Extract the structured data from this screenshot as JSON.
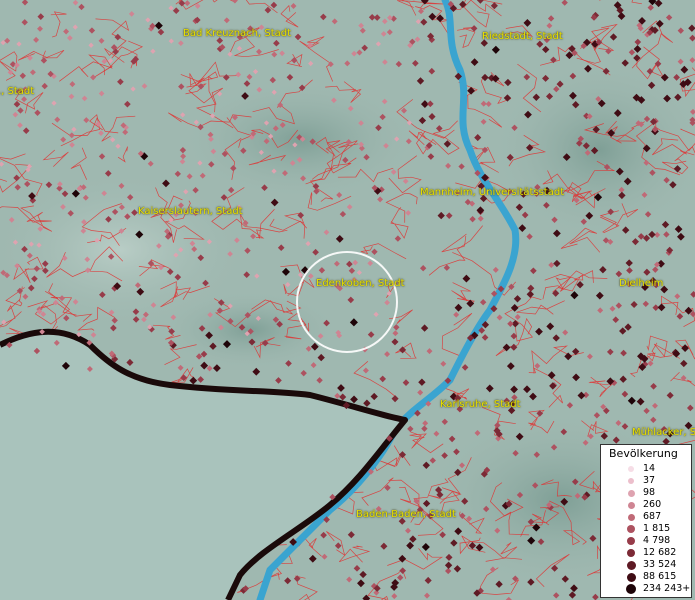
{
  "map": {
    "place_labels": [
      {
        "id": "bad-kreuznach",
        "text": "Bad Kreuznach, Stadt"
      },
      {
        "id": "riedstadt",
        "text": "Riedstadt, Stadt"
      },
      {
        "id": "left-cut",
        "text": "., Stadt"
      },
      {
        "id": "mannheim",
        "text": "Mannheim, Universitätsstadt"
      },
      {
        "id": "kaiserslautern",
        "text": "Kaiserslautern, Stadt"
      },
      {
        "id": "edenkoben",
        "text": "Edenkoben, Stadt"
      },
      {
        "id": "dielheim",
        "text": "Dielheim"
      },
      {
        "id": "karlsruhe",
        "text": "Karlsruhe, Stadt"
      },
      {
        "id": "muehlacker",
        "text": "Mühlacker, S"
      },
      {
        "id": "baden-baden",
        "text": "Baden-Baden, Stadt"
      }
    ],
    "colors": {
      "terrain": "#9fb8b0",
      "river": "#3aa4d0",
      "border_lines": "#e03030",
      "border_state": "#1a0a0a",
      "label_text": "#e8e000"
    }
  },
  "legend": {
    "title": "Bevölkerung",
    "classes": [
      {
        "label": "14",
        "color": "#f6dde6"
      },
      {
        "label": "37",
        "color": "#ecbfcc"
      },
      {
        "label": "98",
        "color": "#dea3b0"
      },
      {
        "label": "260",
        "color": "#cf8593"
      },
      {
        "label": "687",
        "color": "#c06a77"
      },
      {
        "label": "1 815",
        "color": "#ad5260"
      },
      {
        "label": "4 798",
        "color": "#973c4a"
      },
      {
        "label": "12 682",
        "color": "#7c2a36"
      },
      {
        "label": "33 524",
        "color": "#5e1a24"
      },
      {
        "label": "88 615",
        "color": "#3f0c14"
      },
      {
        "label": "234 243+",
        "color": "#1e0408"
      }
    ]
  },
  "selection": {
    "shape": "circle",
    "color": "#ffffff"
  }
}
